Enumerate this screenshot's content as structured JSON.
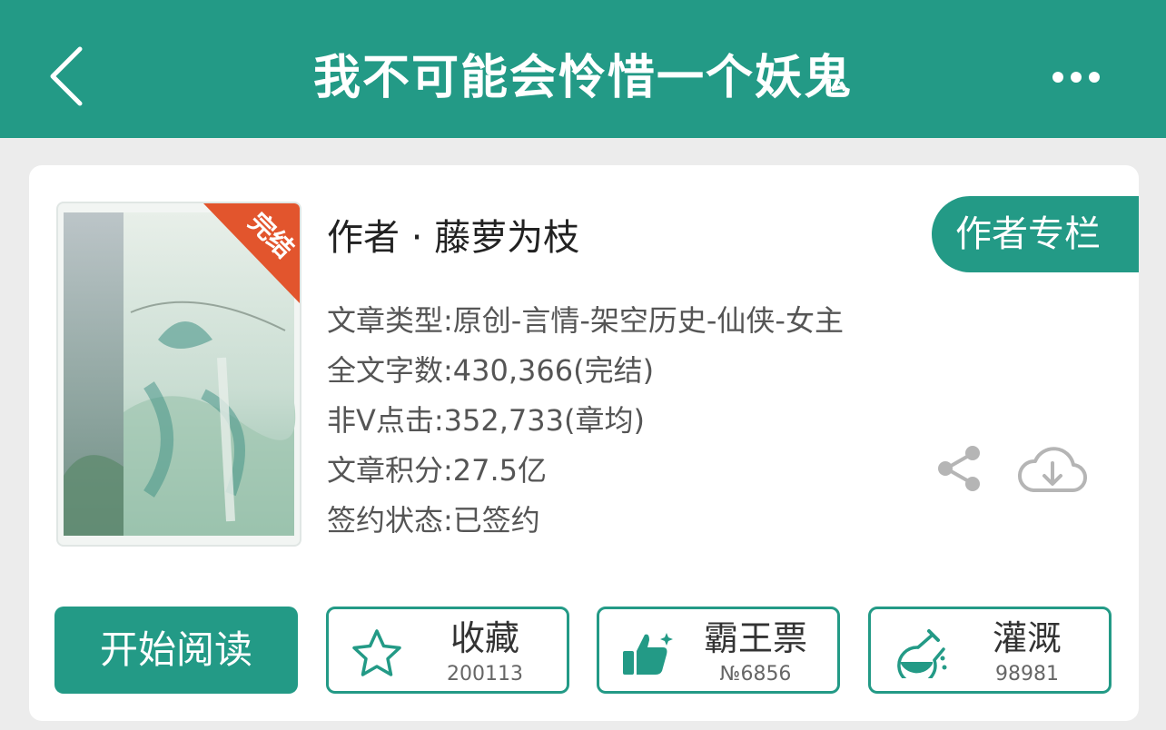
{
  "header": {
    "title": "我不可能会怜惜一个妖鬼",
    "back_icon": "chevron-left-icon",
    "more_icon": "ellipsis-icon",
    "background": "#239a86"
  },
  "book": {
    "cover_badge": "完结",
    "author_line": "作者 · 藤萝为枝",
    "author_column_label": "作者专栏",
    "info": [
      "文章类型:原创-言情-架空历史-仙侠-女主",
      "全文字数:430,366(完结)",
      "非Ⅴ点击:352,733(章均)",
      "文章积分:27.5亿",
      "签约状态:已签约"
    ]
  },
  "actions": {
    "read_label": "开始阅读",
    "favorite": {
      "label": "收藏",
      "count": "200113",
      "icon": "star-icon"
    },
    "vote": {
      "label": "霸王票",
      "count": "№6856",
      "icon": "thumbs-up-icon"
    },
    "nourish": {
      "label": "灌溉",
      "count": "98981",
      "icon": "flask-icon"
    },
    "share_icon": "share-icon",
    "download_icon": "cloud-download-icon"
  },
  "accent_color": "#239a86"
}
